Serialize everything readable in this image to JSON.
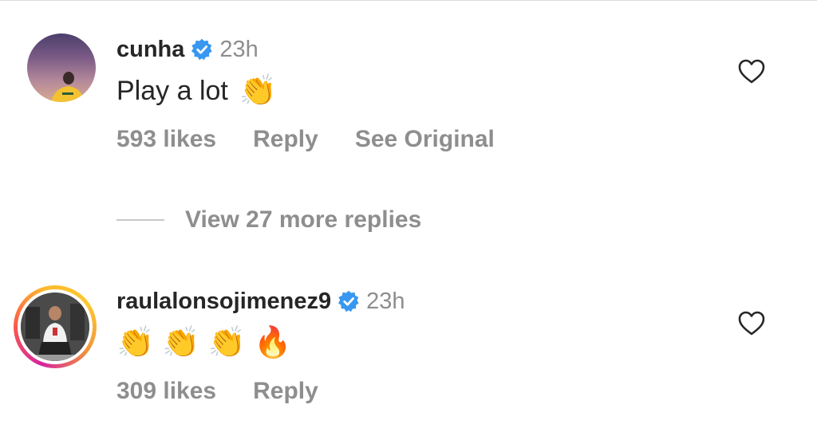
{
  "comments": [
    {
      "username": "cunha",
      "verified": true,
      "time": "23h",
      "text": "Play a lot",
      "emojis": [
        "👏"
      ],
      "likes": "593 likes",
      "reply_label": "Reply",
      "see_original_label": "See Original"
    },
    {
      "username": "raulalonsojimenez9",
      "verified": true,
      "time": "23h",
      "text": "",
      "emojis": [
        "👏",
        "👏",
        "👏",
        "🔥"
      ],
      "likes": "309 likes",
      "reply_label": "Reply"
    }
  ],
  "thread": {
    "view_replies_label": "View 27 more replies"
  },
  "colors": {
    "verified": "#3897f0",
    "muted_text": "#8e8e8e",
    "primary_text": "#262626",
    "story_ring": [
      "#d6249f",
      "#fd5949",
      "#fdb92b"
    ]
  },
  "icons": {
    "verified": "verified-badge-icon",
    "like": "heart-outline-icon"
  }
}
